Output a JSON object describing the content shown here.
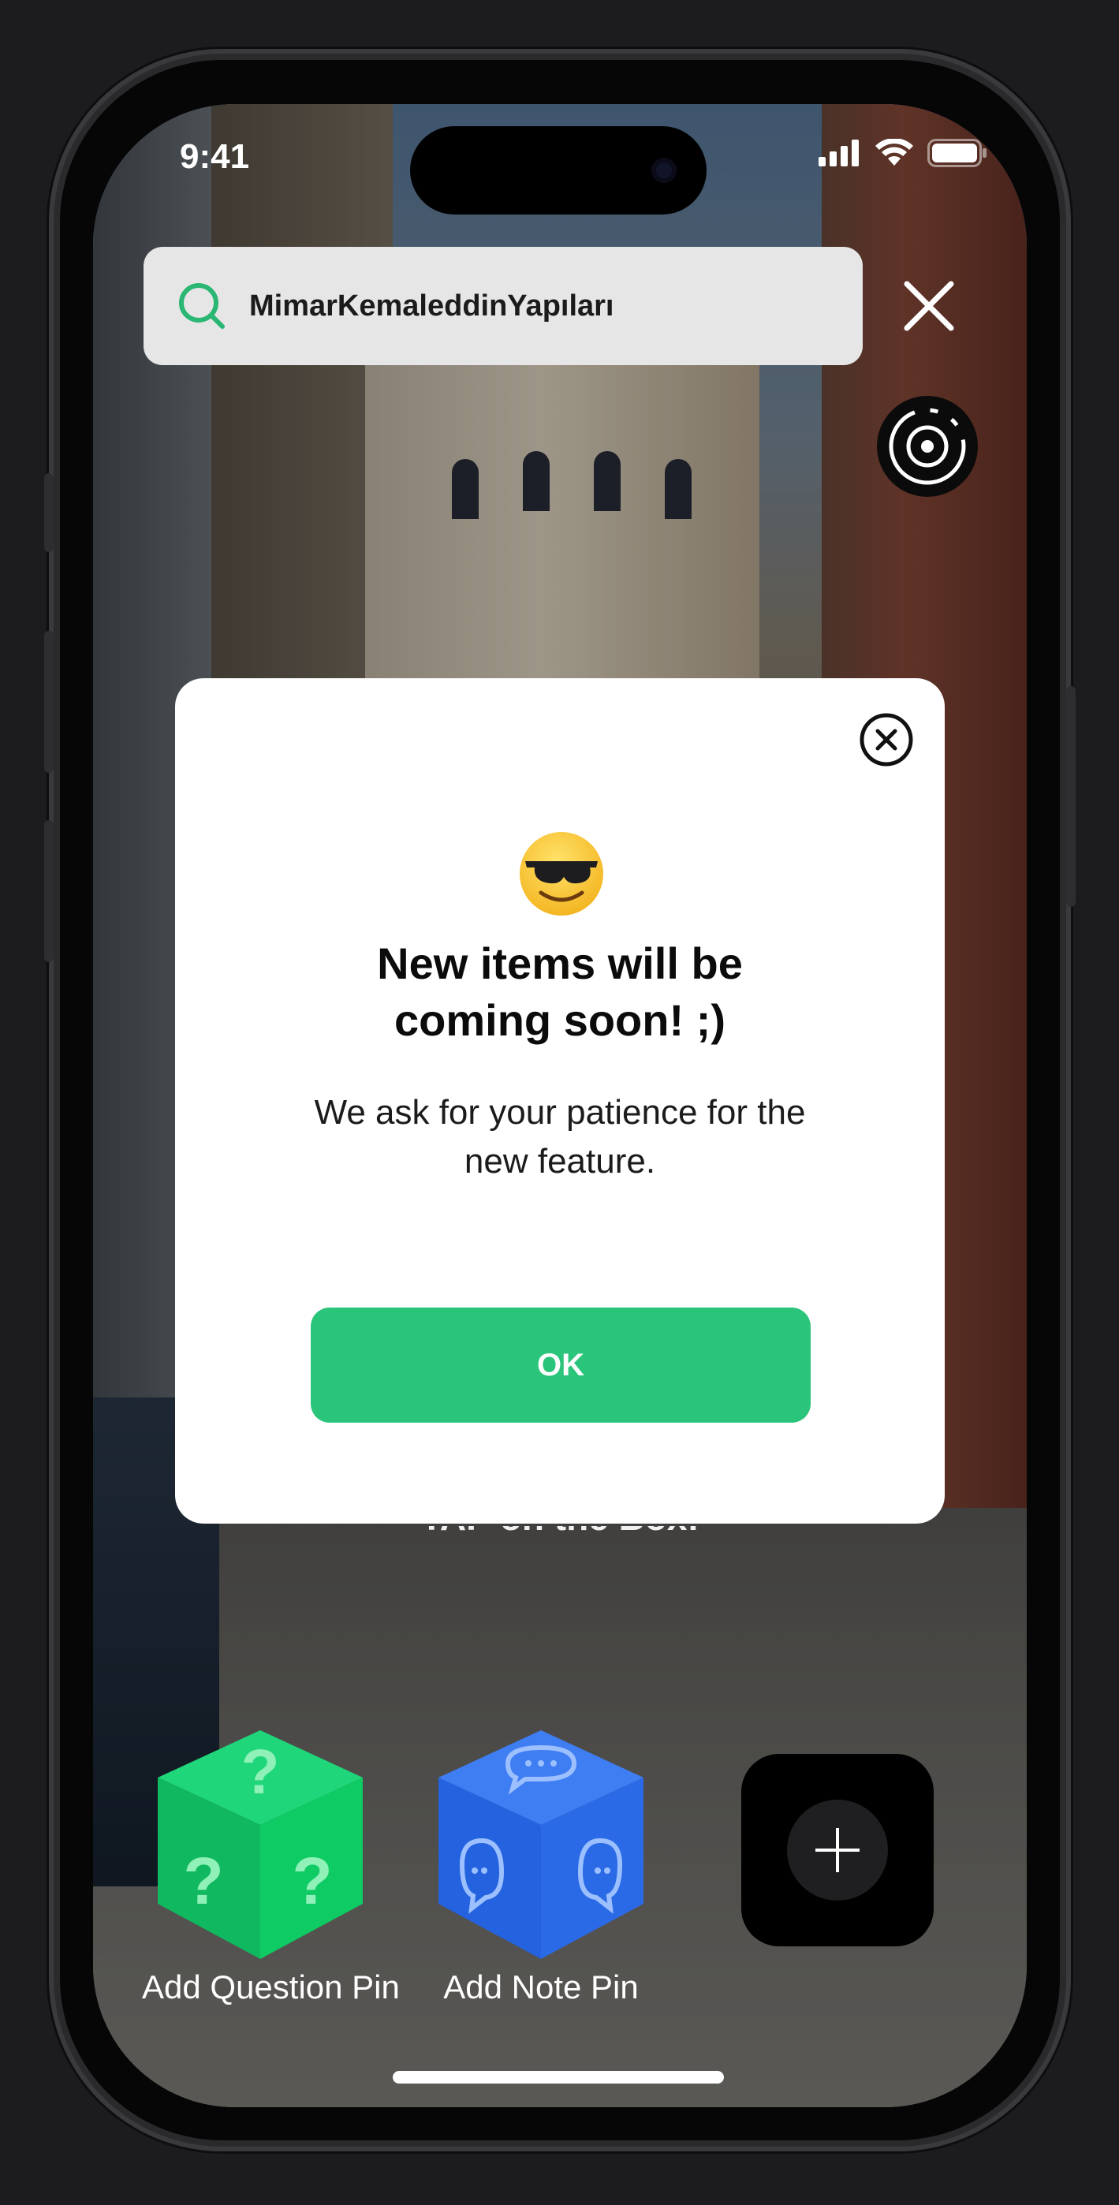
{
  "status_bar": {
    "time": "9:41"
  },
  "search": {
    "query": "MimarKemaleddinYapıları"
  },
  "modal": {
    "emoji": "😎",
    "title_line1": "New items will be",
    "title_line2": "coming soon! ;)",
    "body_line1": "We ask for your patience for the",
    "body_line2": "new feature.",
    "ok_label": "OK"
  },
  "hint": {
    "text": "TAP on the Box!"
  },
  "pins": [
    {
      "label": "Add Question Pin",
      "color": "#14c866"
    },
    {
      "label": "Add Note Pin",
      "color": "#2f6ee8"
    }
  ],
  "colors": {
    "accent": "#2ac57a"
  }
}
